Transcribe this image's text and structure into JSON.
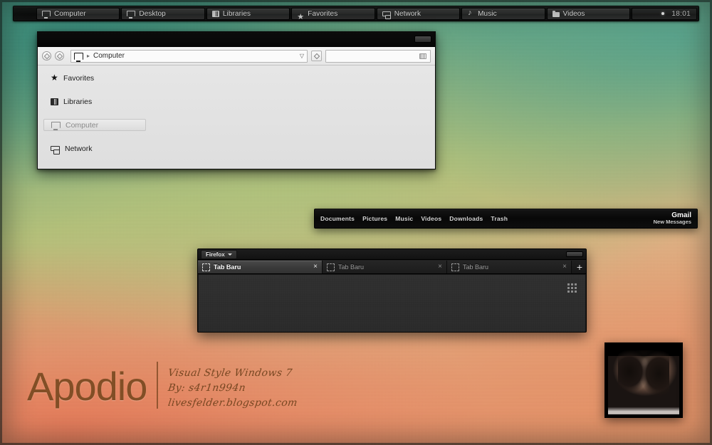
{
  "desktop": {
    "wallpaper_colors": {
      "teal": "#3f8d7a",
      "green": "#b7c077",
      "orange": "#e0b183",
      "salmon": "#e4805e"
    }
  },
  "taskbar": {
    "items": [
      {
        "label": "Computer",
        "icon": "monitor-icon"
      },
      {
        "label": "Desktop",
        "icon": "monitor-icon"
      },
      {
        "label": "Libraries",
        "icon": "library-icon"
      },
      {
        "label": "Favorites",
        "icon": "star-icon"
      },
      {
        "label": "Network",
        "icon": "network-icon"
      },
      {
        "label": "Music",
        "icon": "music-note-icon"
      },
      {
        "label": "Videos",
        "icon": "folder-icon"
      }
    ],
    "tray": {
      "clock": "18:01"
    }
  },
  "explorer": {
    "title": "",
    "toolbar": {
      "back_label": "",
      "forward_label": "",
      "address_icon": "monitor-icon",
      "breadcrumb_separator": "▸",
      "breadcrumb": "Computer",
      "address_caret": "▽",
      "refresh_label": "",
      "search_value": "",
      "search_placeholder": ""
    },
    "sidebar": [
      {
        "label": "Favorites",
        "icon": "star-icon",
        "selected": false
      },
      {
        "label": "Libraries",
        "icon": "library-icon",
        "selected": false
      },
      {
        "label": "Computer",
        "icon": "monitor-icon",
        "selected": true
      },
      {
        "label": "Network",
        "icon": "network-icon",
        "selected": false
      }
    ]
  },
  "dock": {
    "links": [
      {
        "label": "Documents"
      },
      {
        "label": "Pictures"
      },
      {
        "label": "Music"
      },
      {
        "label": "Videos"
      },
      {
        "label": "Downloads"
      },
      {
        "label": "Trash"
      }
    ],
    "gmail": {
      "title": "Gmail",
      "subtitle": "New Messages"
    }
  },
  "firefox": {
    "menu_label": "Firefox",
    "tabs": [
      {
        "title": "Tab Baru",
        "close": "×",
        "active": true
      },
      {
        "title": "Tab Baru",
        "close": "×",
        "active": false
      },
      {
        "title": "Tab Baru",
        "close": "×",
        "active": false
      }
    ],
    "new_tab_label": "+",
    "grid_icon": "grid-icon"
  },
  "branding": {
    "name": "Apodio",
    "lines": [
      "Visual Style Windows 7",
      "By: s4r1n994n",
      "livesfelder.blogspot.com"
    ],
    "accent_color": "#7a4a21"
  },
  "photo_widget": {
    "alt": "portrait-photo"
  }
}
